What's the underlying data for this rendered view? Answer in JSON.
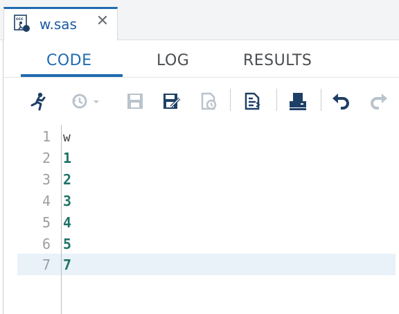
{
  "file_tab": {
    "name": "w.sas",
    "close_glyph": "✕",
    "icon": "sas-program-file-icon"
  },
  "view_tabs": [
    {
      "label": "CODE",
      "active": true
    },
    {
      "label": "LOG",
      "active": false
    },
    {
      "label": "RESULTS",
      "active": false
    }
  ],
  "toolbar": {
    "buttons": [
      {
        "icon": "run-icon",
        "enabled": true
      },
      {
        "icon": "history-icon",
        "enabled": false
      },
      {
        "icon": "save-icon",
        "enabled": false
      },
      {
        "icon": "save-as-icon",
        "enabled": true
      },
      {
        "icon": "format-icon",
        "enabled": false
      },
      {
        "icon": "code-snippet-icon",
        "enabled": true
      },
      {
        "icon": "print-icon",
        "enabled": true
      },
      {
        "icon": "undo-icon",
        "enabled": true
      },
      {
        "icon": "redo-icon",
        "enabled": false
      }
    ]
  },
  "editor": {
    "lines": [
      {
        "number": "1",
        "text": "w"
      },
      {
        "number": "2",
        "text": "1"
      },
      {
        "number": "3",
        "text": "2"
      },
      {
        "number": "4",
        "text": "3"
      },
      {
        "number": "5",
        "text": "4"
      },
      {
        "number": "6",
        "text": "5"
      },
      {
        "number": "7",
        "text": "7"
      }
    ],
    "current_line": 7
  },
  "colors": {
    "accent": "#1f6bb0",
    "code_number": "#1f7367",
    "line_number": "#9b9ea2",
    "current_line_bg": "#e9f1f9",
    "disabled_icon": "#b9c3cc",
    "enabled_icon": "#1e3f66"
  }
}
